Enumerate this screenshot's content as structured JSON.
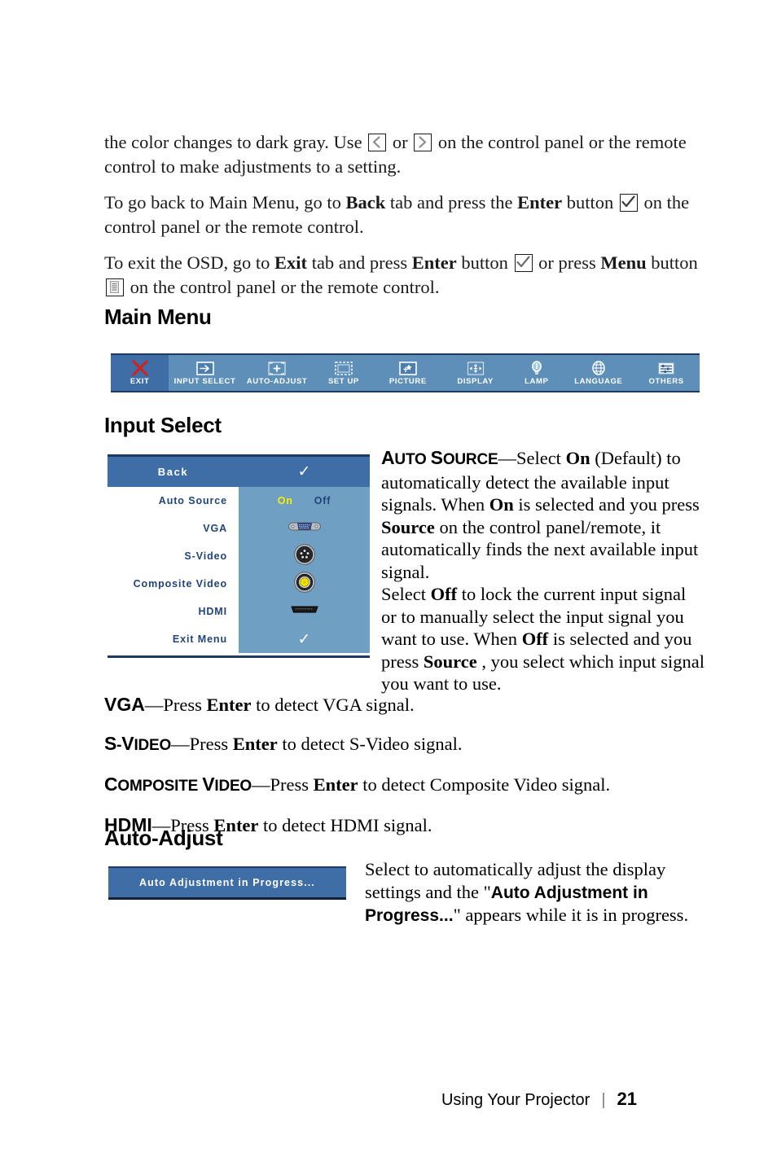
{
  "document": {
    "paragraphs": {
      "p1_part1": "the color changes to dark gray. Use ",
      "p1_mid": " or ",
      "p1_part2": " on the control panel or the remote control to make adjustments to a setting.",
      "p2_part1": "To go back to Main Menu, go to ",
      "p2_back": "Back",
      "p2_part2": " tab and press the ",
      "p2_enter": "Enter",
      "p2_part3": " button ",
      "p2_part4": " on the control panel or the remote control.",
      "p3_part1": "To exit the OSD, go to ",
      "p3_exit": "Exit",
      "p3_part2": " tab and press ",
      "p3_enter": "Enter",
      "p3_part3": " button ",
      "p3_part4": " or press ",
      "p3_menu": "Menu",
      "p3_part5": " button ",
      "p3_part6": " on the control panel or the remote control."
    },
    "headings": {
      "main_menu": "Main Menu",
      "input_select": "Input Select",
      "auto_adjust": "Auto-Adjust"
    }
  },
  "osd_main_menu": {
    "tabs": [
      {
        "label": "EXIT",
        "icon": "x-icon",
        "selected": true
      },
      {
        "label": "INPUT SELECT",
        "icon": "input-arrow-icon",
        "selected": false
      },
      {
        "label": "AUTO-ADJUST",
        "icon": "auto-adjust-icon",
        "selected": false
      },
      {
        "label": "SET UP",
        "icon": "setup-frame-icon",
        "selected": false
      },
      {
        "label": "PICTURE",
        "icon": "picture-icon",
        "selected": false
      },
      {
        "label": "DISPLAY",
        "icon": "display-arrows-icon",
        "selected": false
      },
      {
        "label": "LAMP",
        "icon": "lamp-bulb-icon",
        "selected": false
      },
      {
        "label": "LANGUAGE",
        "icon": "globe-icon",
        "selected": false
      },
      {
        "label": "OTHERS",
        "icon": "sliders-icon",
        "selected": false
      }
    ],
    "colors": {
      "bar_background": "#5d8fb8",
      "selected_tab": "#3f6da6",
      "border": "#1e3a63",
      "label": "#ffffff",
      "exit_x": "#cc2222"
    }
  },
  "osd_input_select": {
    "header": {
      "label": "Back",
      "value_icon": "checkmark-icon"
    },
    "rows": [
      {
        "label": "Auto Source",
        "value_type": "onoff",
        "on": "On",
        "off": "Off",
        "selected": "On"
      },
      {
        "label": "VGA",
        "value_type": "icon",
        "icon": "vga-connector-icon"
      },
      {
        "label": "S-Video",
        "value_type": "icon",
        "icon": "svideo-connector-icon"
      },
      {
        "label": "Composite Video",
        "value_type": "icon",
        "icon": "composite-connector-icon"
      },
      {
        "label": "HDMI",
        "value_type": "icon",
        "icon": "hdmi-connector-icon"
      },
      {
        "label": "Exit Menu",
        "value_type": "check",
        "icon": "checkmark-icon"
      }
    ],
    "colors": {
      "header_bg": "#3f6da6",
      "left_bg": "#ffffff",
      "right_bg": "#6fa0c4",
      "label_text": "#22447a",
      "selected_value": "#f5f000",
      "border": "#1e3a63"
    }
  },
  "auto_source_description": {
    "term": "Auto Source",
    "line1_a": "—Select ",
    "line1_on": "On",
    "line1_b": " (Default) to automatically detect the available input signals. When ",
    "line1_on2": "On",
    "line1_c": " is selected and you press ",
    "line1_source": "Source",
    "line1_d": " on the control panel/remote, it automatically finds the next available input signal.",
    "line2_a": "Select ",
    "line2_off": "Off",
    "line2_b": " to lock the current input signal or to manually select the input signal you want to use. When ",
    "line2_off2": "Off",
    "line2_c": " is selected and you press ",
    "line2_source": "Source",
    "line2_d": " , you select which input signal you want to use."
  },
  "definitions": [
    {
      "term": "VGA",
      "term_style": "allcaps",
      "body_a": "—Press ",
      "enter": "Enter",
      "body_b": " to detect VGA signal."
    },
    {
      "term": "S-Video",
      "term_style": "smallcaps",
      "body_a": "—Press ",
      "enter": "Enter",
      "body_b": " to detect S-Video signal."
    },
    {
      "term": "Composite Video",
      "term_style": "smallcaps",
      "body_a": "—Press ",
      "enter": "Enter",
      "body_b": " to detect Composite Video signal."
    },
    {
      "term": "HDMI",
      "term_style": "allcaps",
      "body_a": "—Press ",
      "enter": "Enter",
      "body_b": " to detect HDMI signal."
    }
  ],
  "auto_adjust": {
    "progress_button_label": "Auto Adjustment in Progress...",
    "description_a": "Select to automatically adjust the display settings and the \"",
    "description_bold": "Auto Adjustment in Progress...",
    "description_b": "\" appears while it is in progress.",
    "colors": {
      "box_bg": "#3f6da6",
      "box_border": "#1e3a63",
      "box_text": "#ffffff"
    }
  },
  "footer": {
    "title": "Using Your Projector",
    "separator": "|",
    "page_number": "21"
  }
}
